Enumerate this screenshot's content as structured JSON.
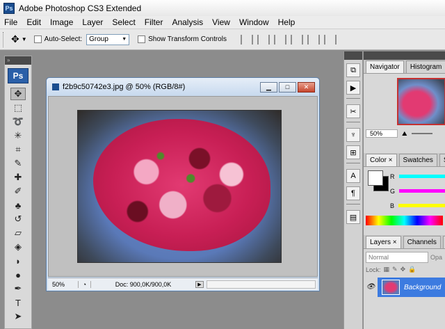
{
  "app": {
    "title": "Adobe Photoshop CS3 Extended",
    "badge": "Ps"
  },
  "menu": [
    "File",
    "Edit",
    "Image",
    "Layer",
    "Select",
    "Filter",
    "Analysis",
    "View",
    "Window",
    "Help"
  ],
  "options": {
    "auto_select_label": "Auto-Select:",
    "auto_select_value": "Group",
    "show_transform_label": "Show Transform Controls"
  },
  "toolbox": {
    "logo": "Ps"
  },
  "document": {
    "title": "f2b9c50742e3.jpg @ 50% (RGB/8#)",
    "zoom": "50%",
    "doc_info": "Doc: 900,0K/900,0K"
  },
  "navigator": {
    "tabs": [
      "Navigator",
      "Histogram"
    ],
    "zoom": "50%"
  },
  "color_panel": {
    "tabs": [
      "Color",
      "Swatches",
      "St"
    ],
    "labels": [
      "R",
      "G",
      "B"
    ],
    "colors": {
      "R": "#00ffff",
      "G": "#ff00ff",
      "B": "#ffff00"
    }
  },
  "layers_panel": {
    "tabs": [
      "Layers",
      "Channels",
      "P"
    ],
    "blend_mode": "Normal",
    "opacity_label": "Opa",
    "lock_label": "Lock:",
    "layer_name": "Background"
  }
}
